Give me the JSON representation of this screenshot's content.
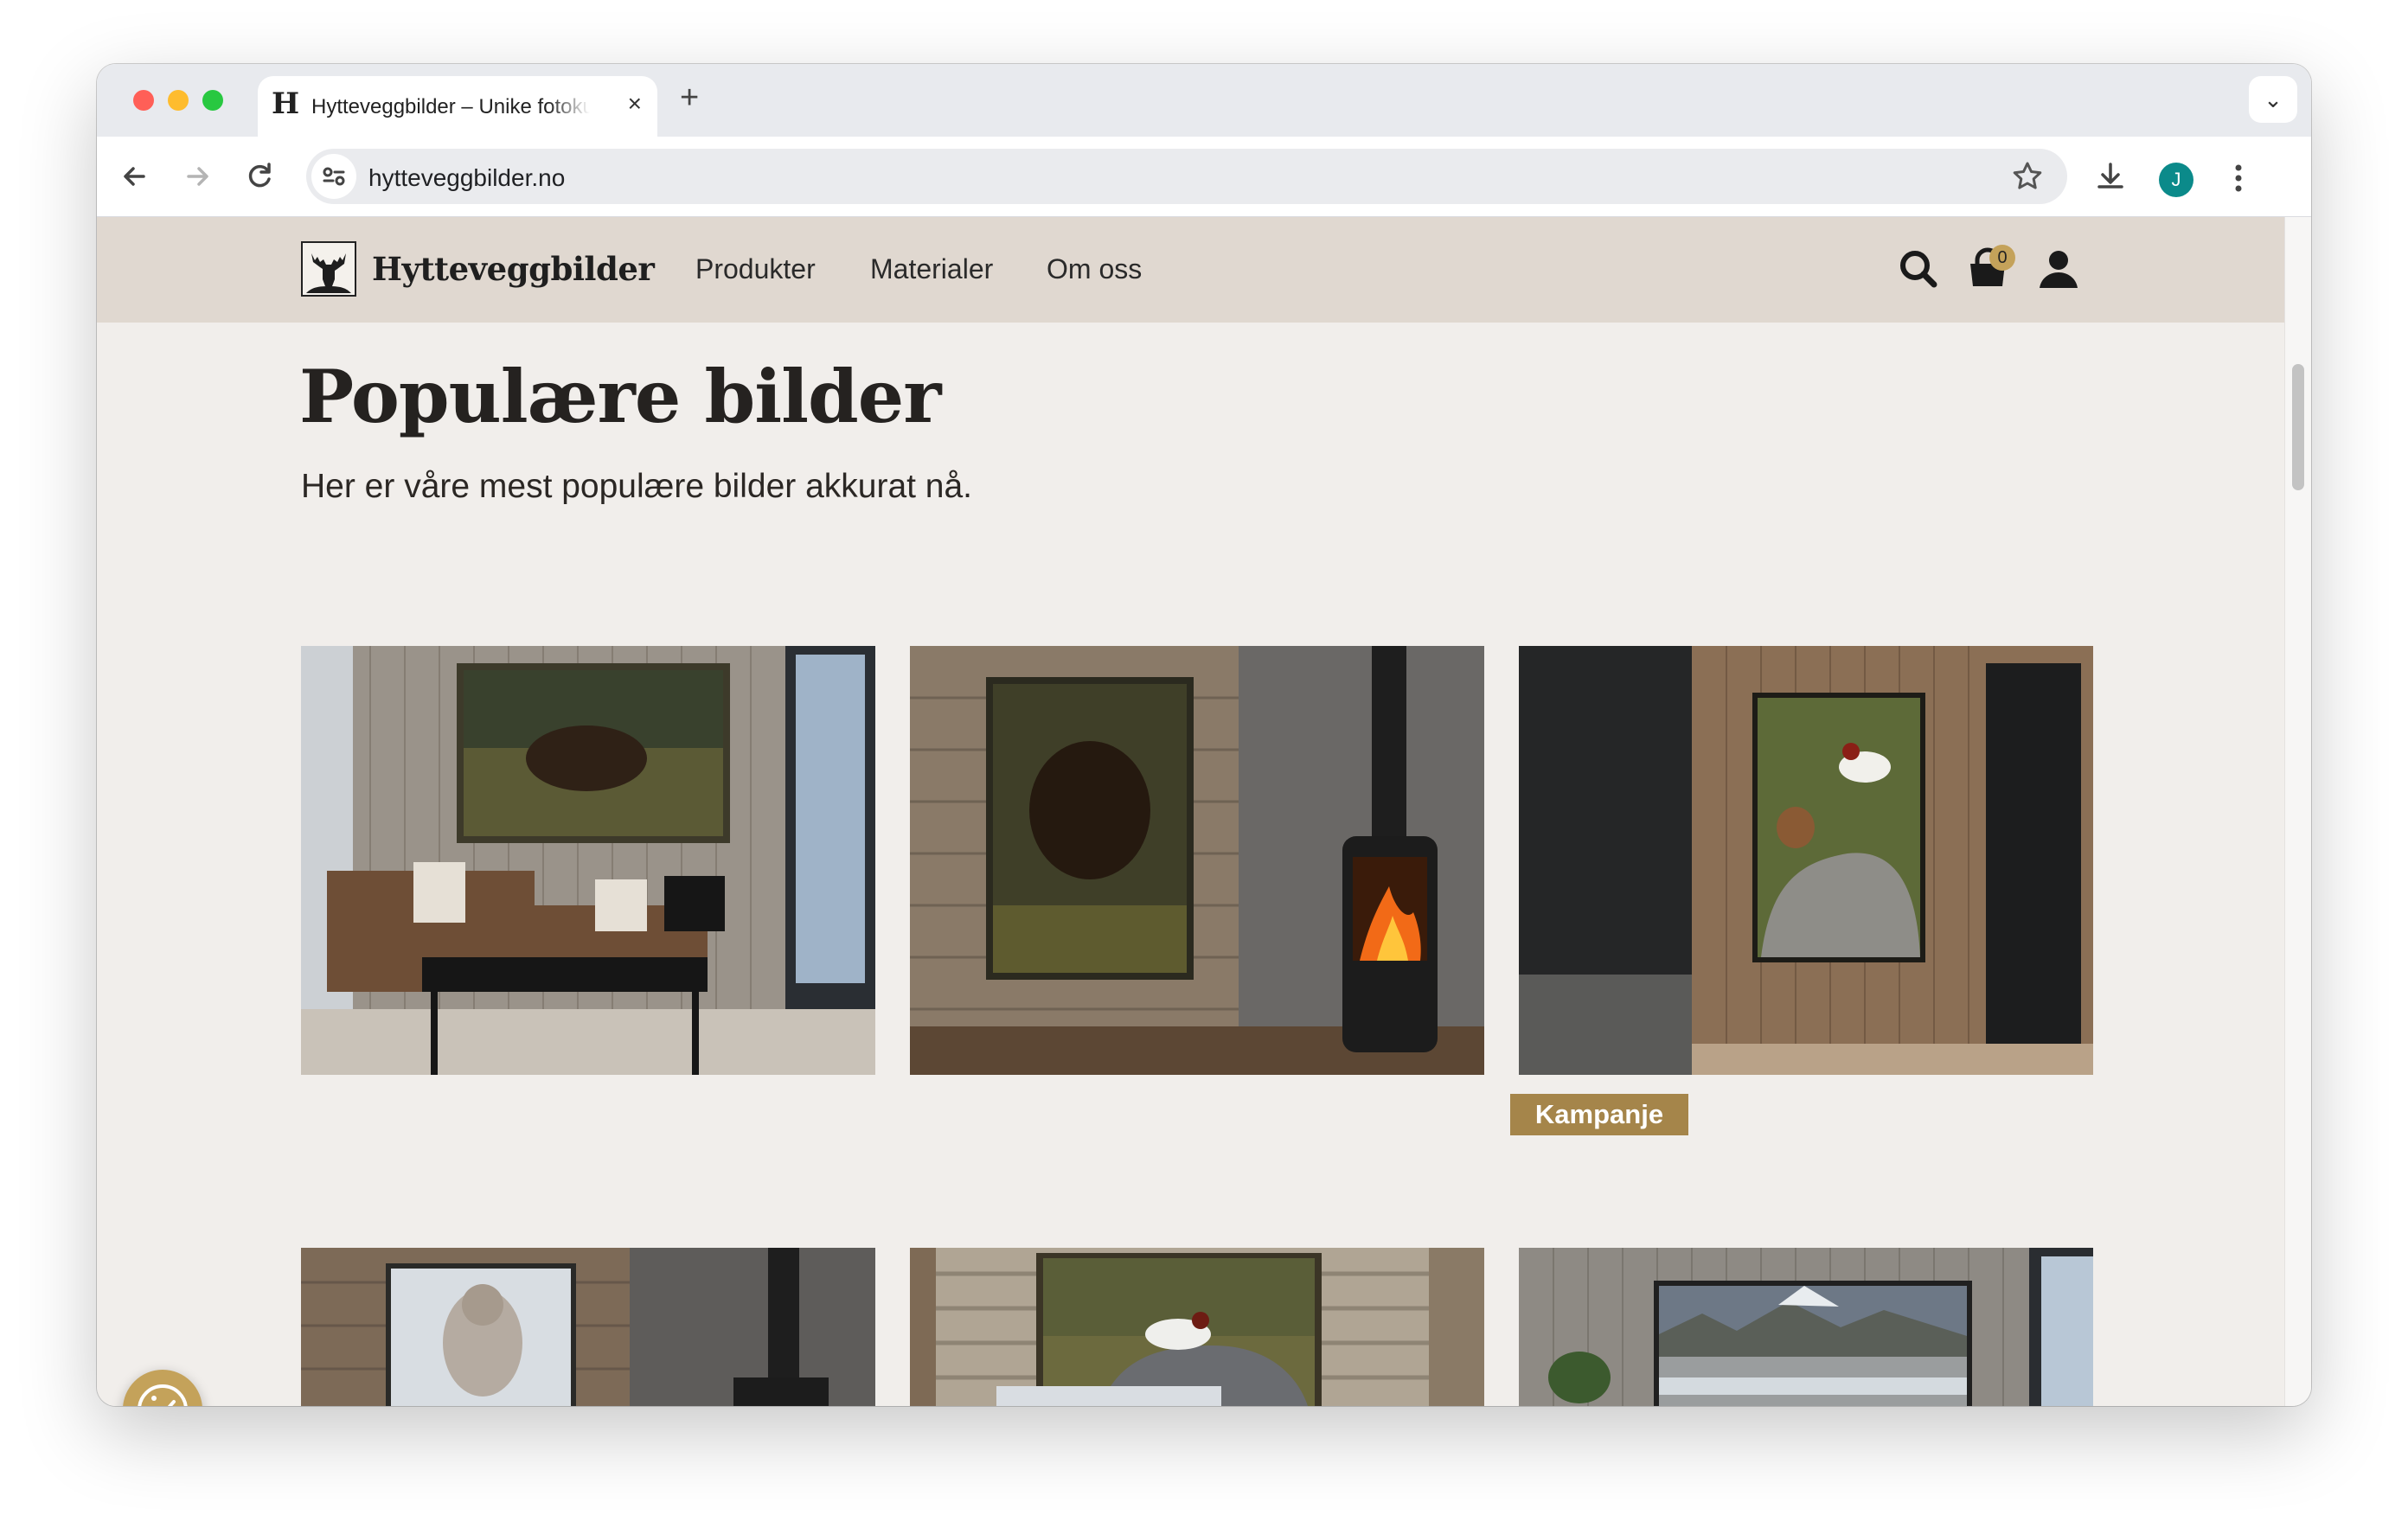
{
  "browser": {
    "tab_favicon": "H",
    "tab_title": "Hytteveggbilder – Unike fotokunst",
    "tab_close_icon": "×",
    "new_tab_icon": "+",
    "tab_search_icon": "⌄",
    "url": "hytteveggbilder.no",
    "profile_initial": "J"
  },
  "site": {
    "brand": "Hytteveggbilder",
    "nav": [
      "Produkter",
      "Materialer",
      "Om oss"
    ],
    "cart_count": "0"
  },
  "main": {
    "title": "Populære bilder",
    "subtitle": "Her er våre mest populære bilder akkurat nå.",
    "campaign_badge": "Kampanje"
  },
  "colors": {
    "header_bg": "#e0d8d0",
    "page_bg": "#f1eeeb",
    "badge_bg": "#a5854a",
    "cookie_bg": "#c4a25a",
    "cart_badge_bg": "#c4a25a"
  },
  "icons": {
    "search": "search-icon",
    "cart": "shopping-bag-icon",
    "account": "user-icon",
    "cookie": "cookie-consent-icon"
  }
}
